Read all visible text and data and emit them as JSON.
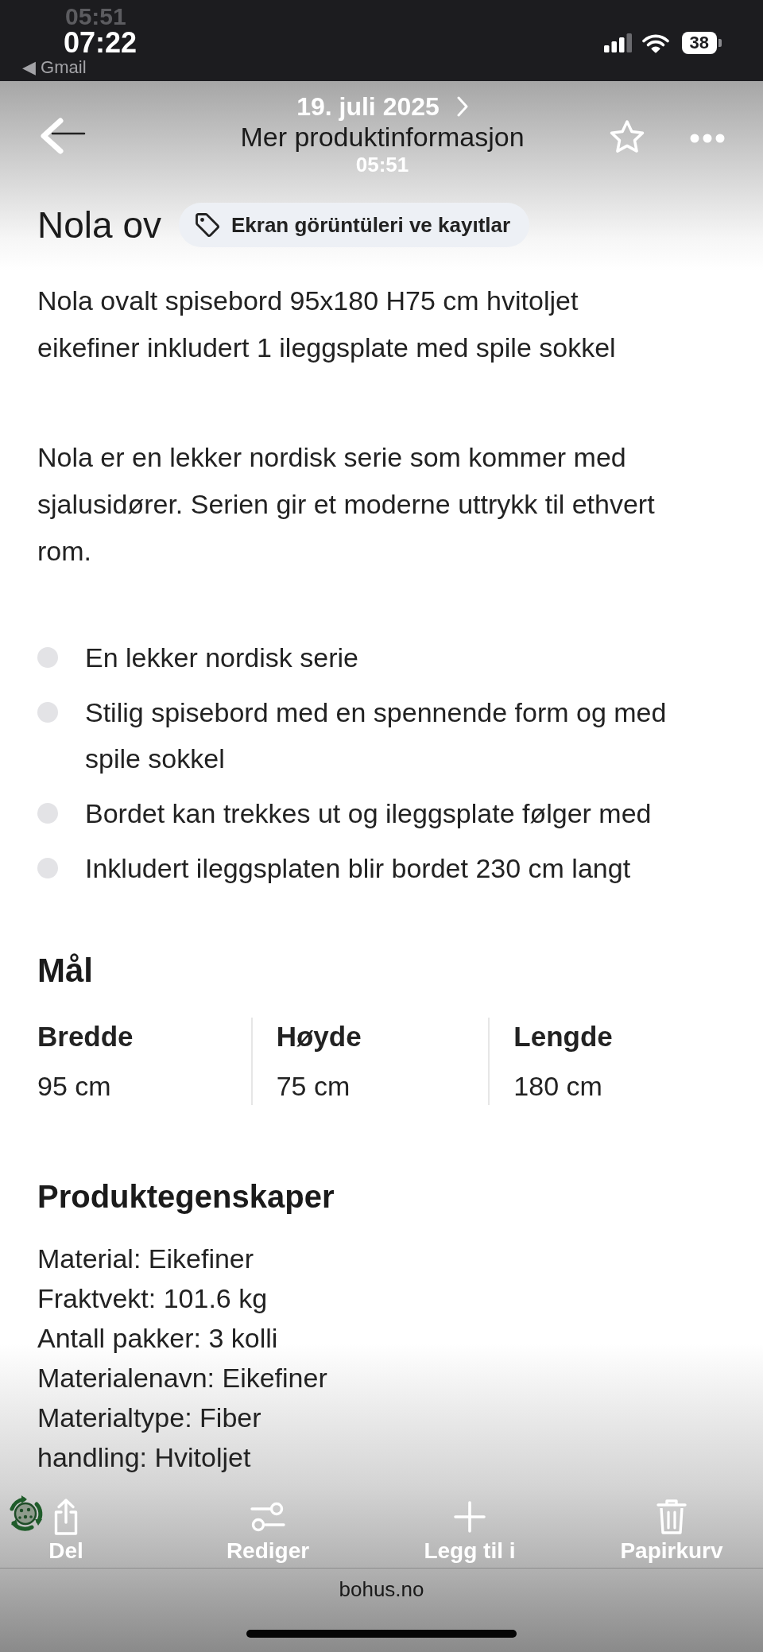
{
  "status_bar": {
    "ghost_time": "05:51",
    "time": "07:22",
    "back_link": "◀ Gmail",
    "battery": "38"
  },
  "header": {
    "date": "19. juli 2025",
    "title": "Mer produktinformasjon",
    "time": "05:51"
  },
  "album_chip": {
    "label": "Ekran görüntüleri ve kayıtlar"
  },
  "product": {
    "heading": "Nola ov",
    "paragraphs": [
      "Nola ovalt spisebord 95x180 H75 cm hvitoljet eikefiner inkludert 1 ileggsplate med spile sokkel",
      "Nola er en lekker nordisk serie som kommer med sjalusidører. Serien gir et moderne uttrykk til ethvert rom."
    ],
    "features": [
      "En lekker nordisk serie",
      "Stilig spisebord med en spennende form og med spile sokkel",
      "Bordet kan trekkes ut og ileggsplate følger med",
      "Inkludert ileggsplaten blir bordet 230 cm langt"
    ]
  },
  "dimensions": {
    "title": "Mål",
    "items": [
      {
        "label": "Bredde",
        "value": "95 cm"
      },
      {
        "label": "Høyde",
        "value": "75 cm"
      },
      {
        "label": "Lengde",
        "value": "180 cm"
      }
    ]
  },
  "properties": {
    "title": "Produktegenskaper",
    "items": [
      "Material: Eikefiner",
      "Fraktvekt: 101.6 kg",
      "Antall pakker: 3 kolli",
      "Materialenavn: Eikefiner",
      "Materialtype: Fiber",
      "handling: Hvitoljet"
    ]
  },
  "toolbar": {
    "buttons": [
      {
        "kind": "share",
        "label": "Del"
      },
      {
        "kind": "edit",
        "label": "Rediger"
      },
      {
        "kind": "add",
        "label": "Legg til i"
      },
      {
        "kind": "trash",
        "label": "Papirkurv"
      }
    ]
  },
  "address_bar": {
    "domain": "bohus.no"
  }
}
